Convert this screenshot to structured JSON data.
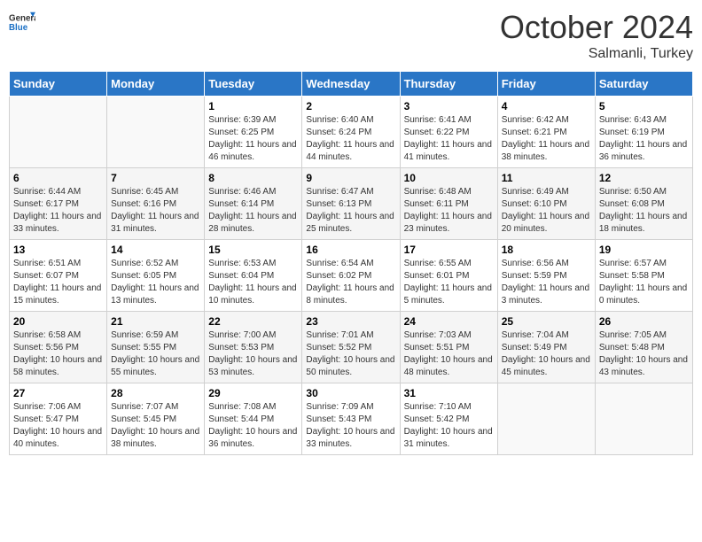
{
  "logo": {
    "general": "General",
    "blue": "Blue"
  },
  "title": "October 2024",
  "location": "Salmanli, Turkey",
  "days_of_week": [
    "Sunday",
    "Monday",
    "Tuesday",
    "Wednesday",
    "Thursday",
    "Friday",
    "Saturday"
  ],
  "weeks": [
    [
      {
        "day": "",
        "sunrise": "",
        "sunset": "",
        "daylight": ""
      },
      {
        "day": "",
        "sunrise": "",
        "sunset": "",
        "daylight": ""
      },
      {
        "day": "1",
        "sunrise": "Sunrise: 6:39 AM",
        "sunset": "Sunset: 6:25 PM",
        "daylight": "Daylight: 11 hours and 46 minutes."
      },
      {
        "day": "2",
        "sunrise": "Sunrise: 6:40 AM",
        "sunset": "Sunset: 6:24 PM",
        "daylight": "Daylight: 11 hours and 44 minutes."
      },
      {
        "day": "3",
        "sunrise": "Sunrise: 6:41 AM",
        "sunset": "Sunset: 6:22 PM",
        "daylight": "Daylight: 11 hours and 41 minutes."
      },
      {
        "day": "4",
        "sunrise": "Sunrise: 6:42 AM",
        "sunset": "Sunset: 6:21 PM",
        "daylight": "Daylight: 11 hours and 38 minutes."
      },
      {
        "day": "5",
        "sunrise": "Sunrise: 6:43 AM",
        "sunset": "Sunset: 6:19 PM",
        "daylight": "Daylight: 11 hours and 36 minutes."
      }
    ],
    [
      {
        "day": "6",
        "sunrise": "Sunrise: 6:44 AM",
        "sunset": "Sunset: 6:17 PM",
        "daylight": "Daylight: 11 hours and 33 minutes."
      },
      {
        "day": "7",
        "sunrise": "Sunrise: 6:45 AM",
        "sunset": "Sunset: 6:16 PM",
        "daylight": "Daylight: 11 hours and 31 minutes."
      },
      {
        "day": "8",
        "sunrise": "Sunrise: 6:46 AM",
        "sunset": "Sunset: 6:14 PM",
        "daylight": "Daylight: 11 hours and 28 minutes."
      },
      {
        "day": "9",
        "sunrise": "Sunrise: 6:47 AM",
        "sunset": "Sunset: 6:13 PM",
        "daylight": "Daylight: 11 hours and 25 minutes."
      },
      {
        "day": "10",
        "sunrise": "Sunrise: 6:48 AM",
        "sunset": "Sunset: 6:11 PM",
        "daylight": "Daylight: 11 hours and 23 minutes."
      },
      {
        "day": "11",
        "sunrise": "Sunrise: 6:49 AM",
        "sunset": "Sunset: 6:10 PM",
        "daylight": "Daylight: 11 hours and 20 minutes."
      },
      {
        "day": "12",
        "sunrise": "Sunrise: 6:50 AM",
        "sunset": "Sunset: 6:08 PM",
        "daylight": "Daylight: 11 hours and 18 minutes."
      }
    ],
    [
      {
        "day": "13",
        "sunrise": "Sunrise: 6:51 AM",
        "sunset": "Sunset: 6:07 PM",
        "daylight": "Daylight: 11 hours and 15 minutes."
      },
      {
        "day": "14",
        "sunrise": "Sunrise: 6:52 AM",
        "sunset": "Sunset: 6:05 PM",
        "daylight": "Daylight: 11 hours and 13 minutes."
      },
      {
        "day": "15",
        "sunrise": "Sunrise: 6:53 AM",
        "sunset": "Sunset: 6:04 PM",
        "daylight": "Daylight: 11 hours and 10 minutes."
      },
      {
        "day": "16",
        "sunrise": "Sunrise: 6:54 AM",
        "sunset": "Sunset: 6:02 PM",
        "daylight": "Daylight: 11 hours and 8 minutes."
      },
      {
        "day": "17",
        "sunrise": "Sunrise: 6:55 AM",
        "sunset": "Sunset: 6:01 PM",
        "daylight": "Daylight: 11 hours and 5 minutes."
      },
      {
        "day": "18",
        "sunrise": "Sunrise: 6:56 AM",
        "sunset": "Sunset: 5:59 PM",
        "daylight": "Daylight: 11 hours and 3 minutes."
      },
      {
        "day": "19",
        "sunrise": "Sunrise: 6:57 AM",
        "sunset": "Sunset: 5:58 PM",
        "daylight": "Daylight: 11 hours and 0 minutes."
      }
    ],
    [
      {
        "day": "20",
        "sunrise": "Sunrise: 6:58 AM",
        "sunset": "Sunset: 5:56 PM",
        "daylight": "Daylight: 10 hours and 58 minutes."
      },
      {
        "day": "21",
        "sunrise": "Sunrise: 6:59 AM",
        "sunset": "Sunset: 5:55 PM",
        "daylight": "Daylight: 10 hours and 55 minutes."
      },
      {
        "day": "22",
        "sunrise": "Sunrise: 7:00 AM",
        "sunset": "Sunset: 5:53 PM",
        "daylight": "Daylight: 10 hours and 53 minutes."
      },
      {
        "day": "23",
        "sunrise": "Sunrise: 7:01 AM",
        "sunset": "Sunset: 5:52 PM",
        "daylight": "Daylight: 10 hours and 50 minutes."
      },
      {
        "day": "24",
        "sunrise": "Sunrise: 7:03 AM",
        "sunset": "Sunset: 5:51 PM",
        "daylight": "Daylight: 10 hours and 48 minutes."
      },
      {
        "day": "25",
        "sunrise": "Sunrise: 7:04 AM",
        "sunset": "Sunset: 5:49 PM",
        "daylight": "Daylight: 10 hours and 45 minutes."
      },
      {
        "day": "26",
        "sunrise": "Sunrise: 7:05 AM",
        "sunset": "Sunset: 5:48 PM",
        "daylight": "Daylight: 10 hours and 43 minutes."
      }
    ],
    [
      {
        "day": "27",
        "sunrise": "Sunrise: 7:06 AM",
        "sunset": "Sunset: 5:47 PM",
        "daylight": "Daylight: 10 hours and 40 minutes."
      },
      {
        "day": "28",
        "sunrise": "Sunrise: 7:07 AM",
        "sunset": "Sunset: 5:45 PM",
        "daylight": "Daylight: 10 hours and 38 minutes."
      },
      {
        "day": "29",
        "sunrise": "Sunrise: 7:08 AM",
        "sunset": "Sunset: 5:44 PM",
        "daylight": "Daylight: 10 hours and 36 minutes."
      },
      {
        "day": "30",
        "sunrise": "Sunrise: 7:09 AM",
        "sunset": "Sunset: 5:43 PM",
        "daylight": "Daylight: 10 hours and 33 minutes."
      },
      {
        "day": "31",
        "sunrise": "Sunrise: 7:10 AM",
        "sunset": "Sunset: 5:42 PM",
        "daylight": "Daylight: 10 hours and 31 minutes."
      },
      {
        "day": "",
        "sunrise": "",
        "sunset": "",
        "daylight": ""
      },
      {
        "day": "",
        "sunrise": "",
        "sunset": "",
        "daylight": ""
      }
    ]
  ]
}
